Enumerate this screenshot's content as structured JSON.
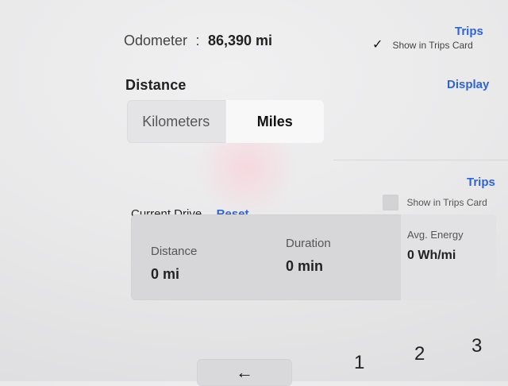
{
  "odometer": {
    "label": "Odometer",
    "separator": ":",
    "value": "86,390 mi"
  },
  "trips_top": {
    "link": "Trips",
    "show_in_trips_card": "Show in Trips Card",
    "checked": true
  },
  "distance": {
    "title": "Distance",
    "display_link": "Display",
    "options": [
      "Kilometers",
      "Miles"
    ],
    "selected": "Miles"
  },
  "current_drive": {
    "trips_link": "Trips",
    "show_in_trips_card": "Show in Trips Card",
    "checked": false,
    "title": "Current Drive",
    "reset": "Reset",
    "stats": [
      {
        "label": "Distance",
        "value": "0 mi"
      },
      {
        "label": "Duration",
        "value": "0 min"
      },
      {
        "label": "Avg. Energy",
        "value": "0 Wh/mi"
      }
    ]
  },
  "bottom": {
    "back_icon": "back-arrow-icon",
    "back_glyph": "←",
    "pages": [
      "1",
      "2",
      "3"
    ]
  }
}
